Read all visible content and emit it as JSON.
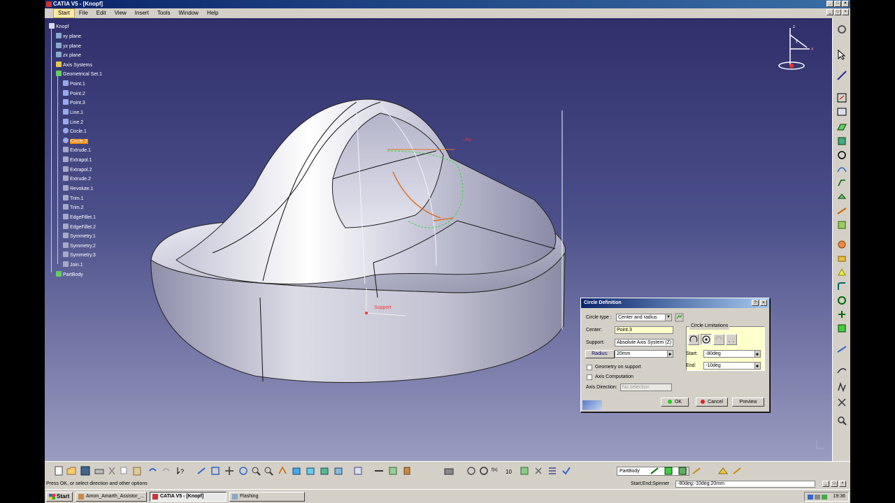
{
  "window": {
    "title": "CATIA V5 - [Knopf]",
    "controls": [
      "_",
      "□",
      "×"
    ]
  },
  "menu": {
    "items": [
      "Start",
      "File",
      "Edit",
      "View",
      "Insert",
      "Tools",
      "Window",
      "Help"
    ],
    "active": "Start"
  },
  "tree": {
    "root": "Knopf",
    "nodes": [
      {
        "label": "xy plane",
        "kind": "plane"
      },
      {
        "label": "yz plane",
        "kind": "plane"
      },
      {
        "label": "zx plane",
        "kind": "plane"
      },
      {
        "label": "Axis Systems",
        "kind": "folder"
      },
      {
        "label": "Geometrical Set.1",
        "kind": "set"
      },
      {
        "label": "Point.1",
        "kind": "point"
      },
      {
        "label": "Point.2",
        "kind": "point"
      },
      {
        "label": "Point.3",
        "kind": "point"
      },
      {
        "label": "Line.1",
        "kind": "line"
      },
      {
        "label": "Line.2",
        "kind": "line"
      },
      {
        "label": "Circle.1",
        "kind": "circle"
      },
      {
        "label": "Circle.2",
        "kind": "circle",
        "selected": true
      },
      {
        "label": "Extrude.1",
        "kind": "surface"
      },
      {
        "label": "Extrapol.1",
        "kind": "surface"
      },
      {
        "label": "Extrapol.2",
        "kind": "surface"
      },
      {
        "label": "Extrude.2",
        "kind": "surface"
      },
      {
        "label": "Revolute.1",
        "kind": "surface"
      },
      {
        "label": "Trim.1",
        "kind": "surface"
      },
      {
        "label": "Trim.2",
        "kind": "surface"
      },
      {
        "label": "EdgeFillet.1",
        "kind": "surface"
      },
      {
        "label": "EdgeFillet.2",
        "kind": "surface"
      },
      {
        "label": "Symmetry.1",
        "kind": "surface"
      },
      {
        "label": "Symmetry.2",
        "kind": "surface"
      },
      {
        "label": "Symmetry.3",
        "kind": "surface"
      },
      {
        "label": "Join.1",
        "kind": "surface"
      },
      {
        "label": "PartBody",
        "kind": "body"
      }
    ]
  },
  "viewport": {
    "annotations": {
      "support": "Support"
    },
    "compass_axes": [
      "x",
      "y",
      "z"
    ]
  },
  "dialog": {
    "title": "Circle Definition",
    "circle_type_label": "Circle type :",
    "circle_type_value": "Center and radius",
    "center_label": "Center:",
    "center_value": "Point.3",
    "support_label": "Support:",
    "support_value": "Absolute Axis System (Z)",
    "radius_label": "Radius:",
    "radius_value": "20mm",
    "geometry_on_support": "Geometry on support",
    "axis_computation": "Axis Computation",
    "axis_direction_label": "Axis Direction:",
    "axis_direction_value": "No selection",
    "limitations_label": "Circle Limitations",
    "start_label": "Start:",
    "start_value": "-80deg",
    "end_label": "End:",
    "end_value": "-10deg",
    "ok": "OK",
    "cancel": "Cancel",
    "preview": "Preview",
    "help": "?",
    "close": "×"
  },
  "bottom_toolbar": {
    "part_selector": "PartBody"
  },
  "status": {
    "message": "Press OK, or select direction and other options",
    "spinner_label": "Start;End;Spinner",
    "spinner_value": "-80deg;-10deg;20mm"
  },
  "taskbar": {
    "start": "Start",
    "tasks": [
      {
        "label": "Amon_Amarth_Assistor_...",
        "active": false
      },
      {
        "label": "CATIA V5 - [Knopf]",
        "active": true
      },
      {
        "label": "Flashing",
        "active": false
      }
    ],
    "clock": "19:36"
  },
  "colors": {
    "accent": "#f08a10",
    "title_gradient_start": "#0a246a",
    "viewport_top": "#2f2f6b",
    "viewport_bottom": "#9a9cc0",
    "preview_green": "#33dd33",
    "annotation_red": "#ff3030"
  }
}
